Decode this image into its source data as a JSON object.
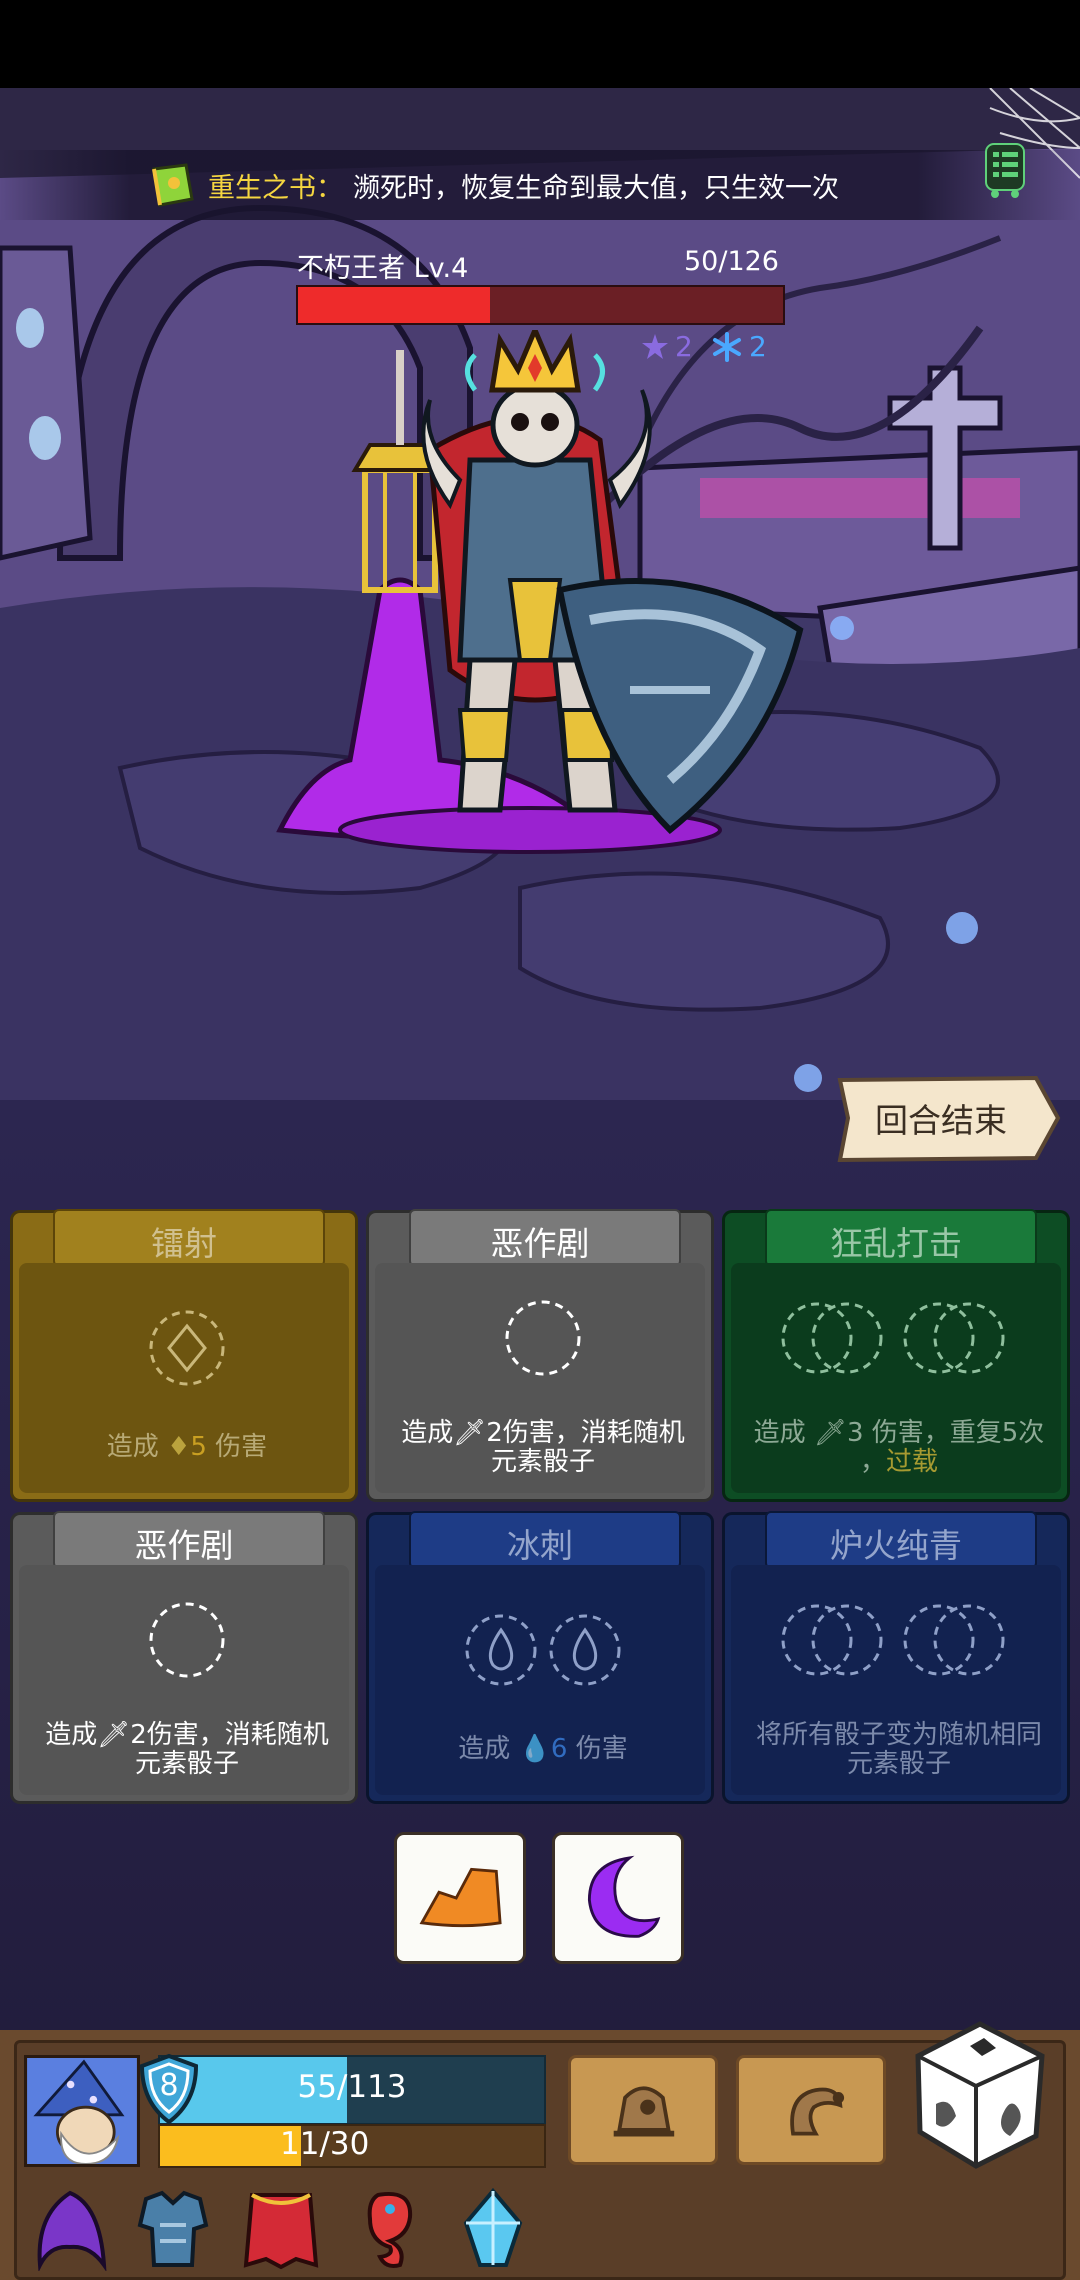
{
  "relic": {
    "name": "重生之书：",
    "description": "濒死时，恢复生命到最大值，只生效一次",
    "icon": "book-icon"
  },
  "boss": {
    "name": "不朽王者  Lv.4",
    "hp_text": "50/126",
    "hp": 50,
    "hp_max": 126,
    "statuses": [
      {
        "icon": "poison-icon",
        "value": "2",
        "color": "#8a6be0"
      },
      {
        "icon": "frost-icon",
        "value": "2",
        "color": "#4aa8ff"
      }
    ]
  },
  "end_turn_label": "回合结束",
  "cards": [
    {
      "title": "镭射",
      "desc_pre": "造成 ",
      "desc_num": "5",
      "desc_post": " 伤害",
      "theme": "olive"
    },
    {
      "title": "恶作剧",
      "desc_line1": "造成",
      "desc_num": "2",
      "desc_line1b": "伤害，消耗随机",
      "desc_line2": "元素骰子",
      "theme": "grey"
    },
    {
      "title": "狂乱打击",
      "desc_pre": "造成 ",
      "desc_num": "3",
      "desc_post": " 伤害，重复5次",
      "desc_line2a": "，",
      "desc_keyword": "过载",
      "theme": "green"
    },
    {
      "title": "恶作剧",
      "desc_line1": "造成",
      "desc_num": "2",
      "desc_line1b": "伤害，消耗随机",
      "desc_line2": "元素骰子",
      "theme": "grey"
    },
    {
      "title": "冰刺",
      "desc_pre": "造成 ",
      "desc_num": "6",
      "desc_post": " 伤害",
      "theme": "navy"
    },
    {
      "title": "炉火纯青",
      "desc_line1": "将所有骰子变为随机相同",
      "desc_line2": "元素骰子",
      "theme": "navy"
    }
  ],
  "dice_tray": [
    {
      "icon": "fire-die-icon",
      "color": "#f08a24"
    },
    {
      "icon": "moon-die-icon",
      "color": "#9b2cf2"
    }
  ],
  "player": {
    "shield": "8",
    "hp_text": "55/113",
    "hp": 55,
    "hp_max": 113,
    "xp_text": "11/30",
    "xp": 11,
    "xp_max": 30
  },
  "equipment": [
    "hood-icon",
    "armor-icon",
    "cape-icon",
    "seahorse-icon",
    "crystal-icon"
  ],
  "colors": {
    "boss_hp": "#ee2b2b",
    "player_hp": "#58c8ec",
    "player_xp": "#fbbd1e"
  }
}
